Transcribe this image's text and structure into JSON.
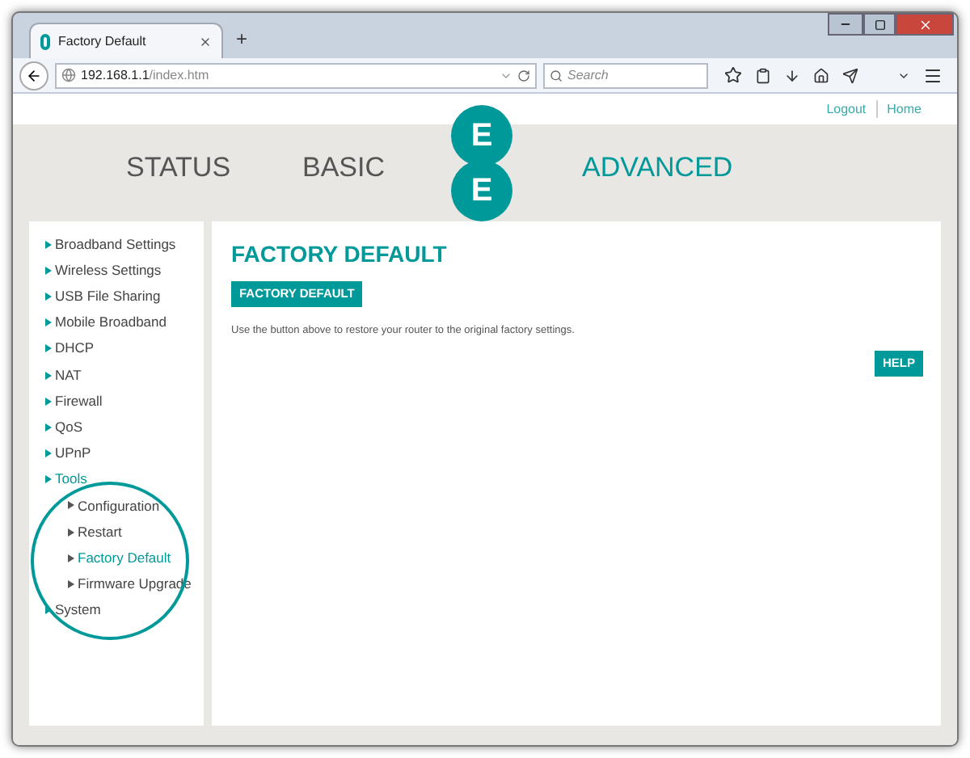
{
  "browser": {
    "tab_title": "Factory Default",
    "new_tab": "+",
    "url_host": "192.168.1.1",
    "url_path": "/index.htm",
    "search_placeholder": "Search"
  },
  "top_links": [
    {
      "label": "Logout"
    },
    {
      "label": "Home"
    }
  ],
  "nav": [
    {
      "label": "STATUS",
      "selected": false
    },
    {
      "label": "BASIC",
      "selected": false
    },
    {
      "label": "ADVANCED",
      "selected": true
    }
  ],
  "logo": {
    "letters": [
      "E",
      "E"
    ]
  },
  "sidebar": {
    "items": [
      {
        "label": "Broadband Settings",
        "selected": false
      },
      {
        "label": "Wireless Settings",
        "selected": false
      },
      {
        "label": "USB File Sharing",
        "selected": false
      },
      {
        "label": "Mobile Broadband",
        "selected": false
      },
      {
        "label": "DHCP",
        "selected": false
      },
      {
        "label": "NAT",
        "selected": false
      },
      {
        "label": "Firewall",
        "selected": false
      },
      {
        "label": "QoS",
        "selected": false
      },
      {
        "label": "UPnP",
        "selected": false
      },
      {
        "label": "Tools",
        "selected": true,
        "children": [
          {
            "label": "Configuration",
            "selected": false
          },
          {
            "label": "Restart",
            "selected": false
          },
          {
            "label": "Factory Default",
            "selected": true
          },
          {
            "label": "Firmware Upgrade",
            "selected": false
          }
        ]
      },
      {
        "label": "System",
        "selected": false
      }
    ]
  },
  "main": {
    "title": "FACTORY DEFAULT",
    "button": "FACTORY DEFAULT",
    "description": "Use the button above to restore your router to the original factory settings.",
    "help_button": "HELP"
  }
}
